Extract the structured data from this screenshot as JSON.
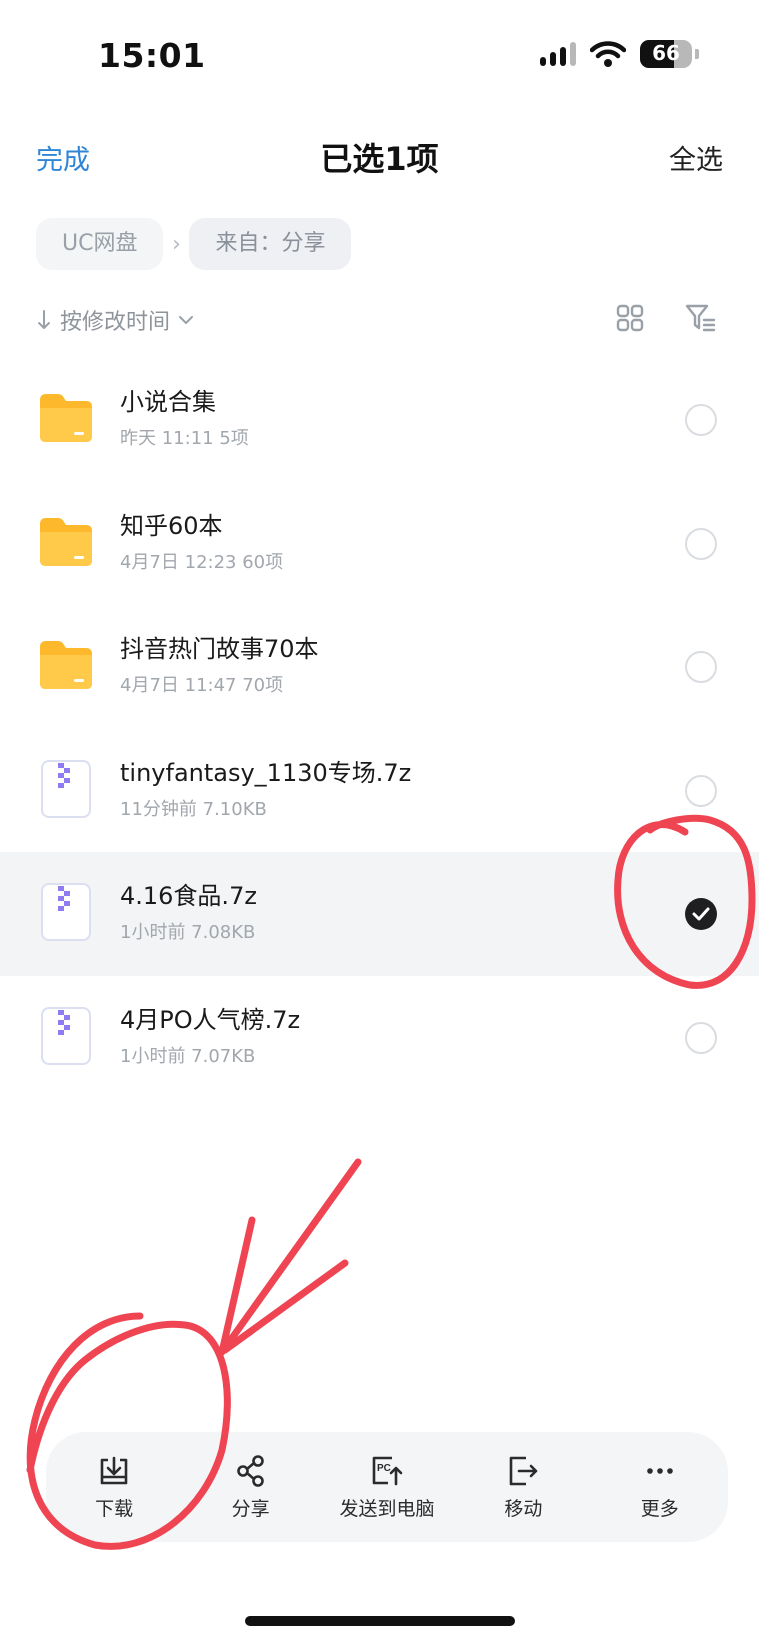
{
  "status_bar": {
    "time": "15:01",
    "battery": "66",
    "battery_level": 0.66
  },
  "header": {
    "done_label": "完成",
    "title": "已选1项",
    "select_all_label": "全选"
  },
  "breadcrumb": [
    {
      "label": "UC网盘"
    },
    {
      "label": "来自：分享"
    }
  ],
  "sort": {
    "label": "按修改时间"
  },
  "files": [
    {
      "name": "小说合集",
      "meta": "昨天 11:11  5项",
      "type": "folder",
      "selected": false
    },
    {
      "name": "知乎60本",
      "meta": "4月7日 12:23  60项",
      "type": "folder",
      "selected": false
    },
    {
      "name": "抖音热门故事70本",
      "meta": "4月7日 11:47  70项",
      "type": "folder",
      "selected": false
    },
    {
      "name": "tinyfantasy_1130专场.7z",
      "meta": "11分钟前  7.10KB",
      "type": "archive",
      "selected": false
    },
    {
      "name": "4.16食品.7z",
      "meta": "1小时前  7.08KB",
      "type": "archive",
      "selected": true
    },
    {
      "name": "4月PO人气榜.7z",
      "meta": "1小时前  7.07KB",
      "type": "archive",
      "selected": false
    }
  ],
  "toolbar": {
    "download_label": "下载",
    "share_label": "分享",
    "send_pc_label": "发送到电脑",
    "move_label": "移动",
    "more_label": "更多"
  },
  "colors": {
    "accent": "#2f86d6",
    "folder": "#fdb92b",
    "archive_zipper": "#8d7cf2",
    "annotation": "#ef4452"
  }
}
